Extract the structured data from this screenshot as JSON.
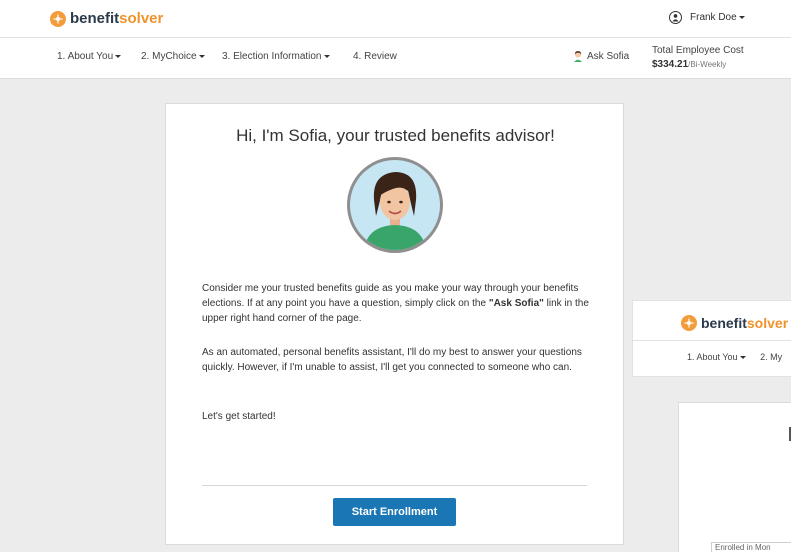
{
  "brand": {
    "part1": "benefit",
    "part2": "solver"
  },
  "user": {
    "name": "Frank Doe"
  },
  "nav": {
    "items": [
      {
        "label": "1. About You",
        "dropdown": true
      },
      {
        "label": "2. MyChoice",
        "dropdown": true
      },
      {
        "label": "3. Election Information",
        "dropdown": true
      },
      {
        "label": "4. Review",
        "dropdown": false
      }
    ],
    "ask": "Ask Sofia",
    "cost_label": "Total Employee Cost",
    "cost_amount": "$334.21",
    "cost_period": "/Bi-Weekly"
  },
  "card": {
    "title": "Hi, I'm Sofia, your trusted benefits advisor!",
    "p1_before": "Consider me your trusted benefits guide as you make your way through your benefits elections. If at any point you have a question, simply click on the ",
    "p1_link": "\"Ask Sofia\"",
    "p1_after": " link in the upper right hand corner of the page.",
    "p2": "As an automated, personal benefits assistant, I'll do my best to answer your questions quickly. However, if I'm unable to assist, I'll get you connected to someone who can.",
    "p3": "Let's get started!",
    "button": "Start Enrollment"
  },
  "background_page": {
    "nav_text": "1. About You",
    "nav_text_2": "2. My",
    "bottom_text": "Enrolled in Mon"
  },
  "colors": {
    "accent": "#f0932b",
    "brand_dark": "#2b3a4a",
    "button": "#1b76b6",
    "page_bg": "#ececec"
  }
}
